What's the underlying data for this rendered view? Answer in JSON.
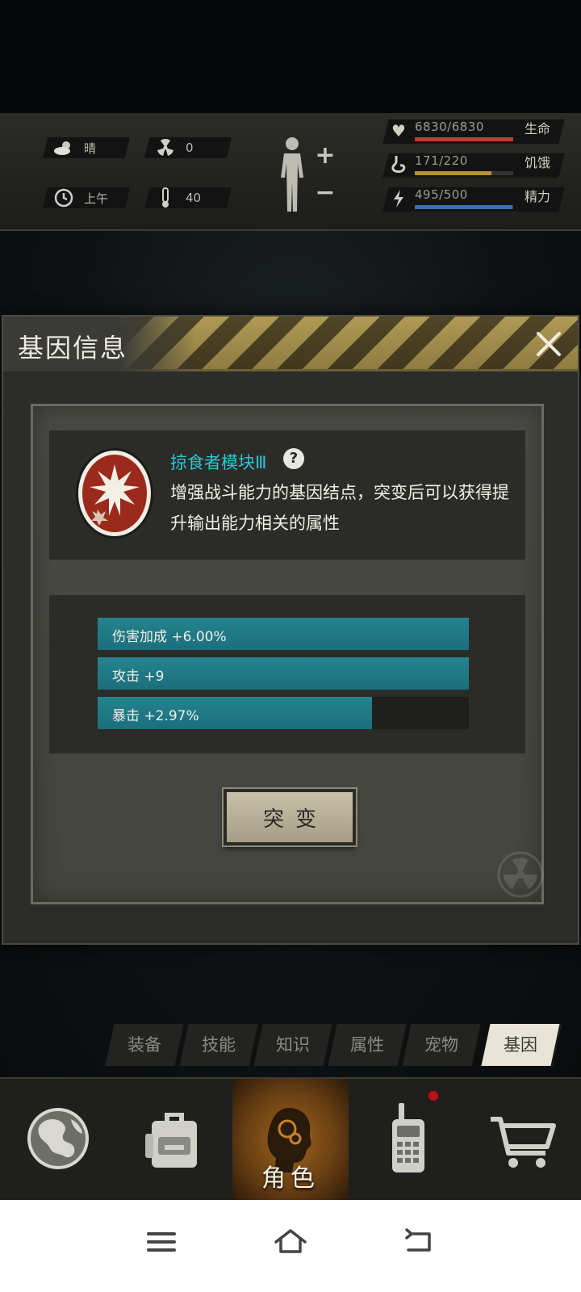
{
  "status": {
    "weather": {
      "icon": "cloud-sun-icon",
      "value": "晴"
    },
    "radiation": {
      "icon": "radiation-icon",
      "value": "0"
    },
    "time": {
      "icon": "clock-icon",
      "value": "上午"
    },
    "temperature": {
      "icon": "thermometer-icon",
      "value": "40"
    },
    "vitals": [
      {
        "icon": "heart-icon",
        "value": "6830/6830",
        "label": "生命",
        "fraction": 1.0,
        "color": "#c23a32"
      },
      {
        "icon": "stomach-icon",
        "value": "171/220",
        "label": "饥饿",
        "fraction": 0.777,
        "color": "#b59136"
      },
      {
        "icon": "energy-icon",
        "value": "495/500",
        "label": "精力",
        "fraction": 0.99,
        "color": "#3a6fb0"
      }
    ]
  },
  "modal": {
    "title": "基因信息",
    "gene": {
      "name": "掠食者模块Ⅲ",
      "description": "增强战斗能力的基因结点，突变后可以获得提升输出能力相关的属性"
    },
    "stats": [
      {
        "text": "伤害加成 +6.00%",
        "fraction": 1.0
      },
      {
        "text": "攻击 +9",
        "fraction": 1.0
      },
      {
        "text": "暴击 +2.97%",
        "fraction": 0.74
      }
    ],
    "mutate_label": "突变"
  },
  "tabs": [
    {
      "label": "装备",
      "active": false
    },
    {
      "label": "技能",
      "active": false
    },
    {
      "label": "知识",
      "active": false
    },
    {
      "label": "属性",
      "active": false
    },
    {
      "label": "宠物",
      "active": false
    },
    {
      "label": "基因",
      "active": true
    }
  ],
  "bottom_nav": {
    "world": {
      "icon": "globe-icon"
    },
    "backpack": {
      "icon": "backpack-icon"
    },
    "character": {
      "icon": "character-head-icon",
      "label": "角色"
    },
    "radio": {
      "icon": "walkie-talkie-icon"
    },
    "shop": {
      "icon": "shopping-cart-icon"
    }
  },
  "colors": {
    "accent_cyan": "#2ec4d4",
    "stat_fill": "#1f7884",
    "active_nav": "#a0651e",
    "hazard_yellow": "#b09a55"
  }
}
